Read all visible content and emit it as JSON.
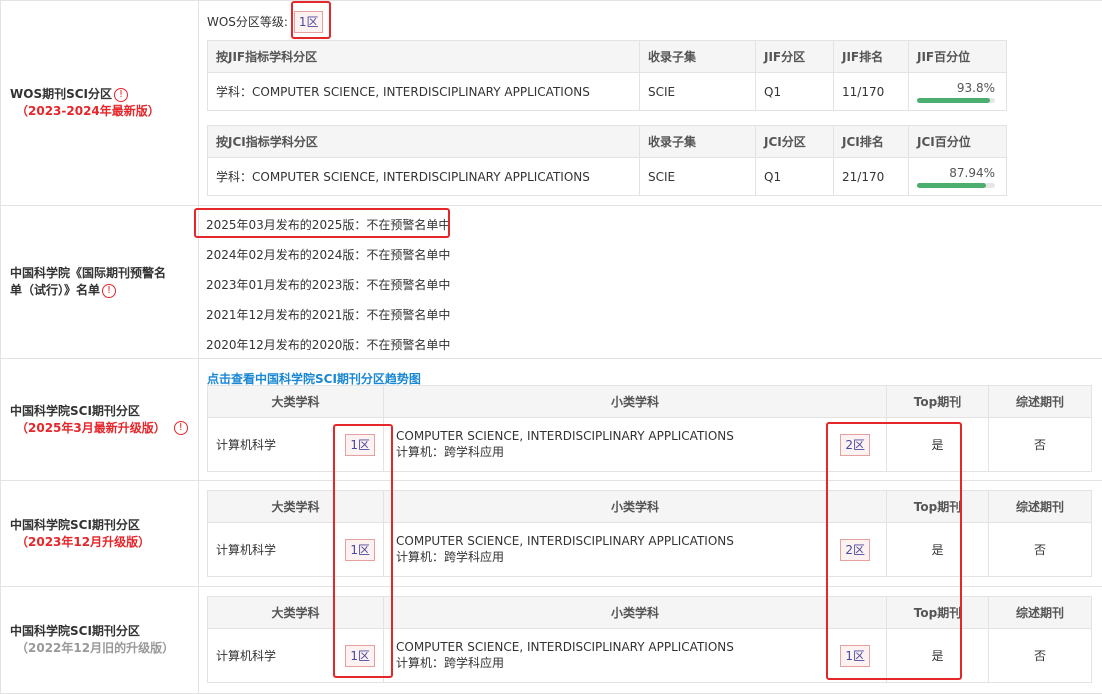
{
  "wos": {
    "label": "WOS期刊SCI分区",
    "sub": "（2023-2024年最新版）",
    "grade_label": "WOS分区等级:",
    "grade": "1区",
    "jif": {
      "headers": [
        "按JIF指标学科分区",
        "收录子集",
        "JIF分区",
        "JIF排名",
        "JIF百分位"
      ],
      "row": [
        "学科：COMPUTER SCIENCE, INTERDISCIPLINARY APPLICATIONS",
        "SCIE",
        "Q1",
        "11/170",
        "93.8%"
      ],
      "pct_value": 93.8
    },
    "jci": {
      "headers": [
        "按JCI指标学科分区",
        "收录子集",
        "JCI分区",
        "JCI排名",
        "JCI百分位"
      ],
      "row": [
        "学科：COMPUTER SCIENCE, INTERDISCIPLINARY APPLICATIONS",
        "SCIE",
        "Q1",
        "21/170",
        "87.94%"
      ],
      "pct_value": 87.94
    }
  },
  "warning": {
    "label": "中国科学院《国际期刊预警名单（试行）》名单",
    "items": [
      "2025年03月发布的2025版：不在预警名单中",
      "2024年02月发布的2024版：不在预警名单中",
      "2023年01月发布的2023版：不在预警名单中",
      "2021年12月发布的2021版：不在预警名单中",
      "2020年12月发布的2020版：不在预警名单中"
    ]
  },
  "cas": {
    "link": "点击查看中国科学院SCI期刊分区趋势图",
    "headers": [
      "大类学科",
      "小类学科",
      "Top期刊",
      "综述期刊"
    ],
    "sections": [
      {
        "label": "中国科学院SCI期刊分区",
        "sub": "（2025年3月最新升级版）",
        "major": "计算机科学",
        "major_zone": "1区",
        "minor_en": "COMPUTER SCIENCE, INTERDISCIPLINARY APPLICATIONS",
        "minor_cn": "计算机：跨学科应用",
        "minor_zone": "2区",
        "top": "是",
        "review": "否"
      },
      {
        "label": "中国科学院SCI期刊分区",
        "sub": "（2023年12月升级版）",
        "major": "计算机科学",
        "major_zone": "1区",
        "minor_en": "COMPUTER SCIENCE, INTERDISCIPLINARY APPLICATIONS",
        "minor_cn": "计算机：跨学科应用",
        "minor_zone": "2区",
        "top": "是",
        "review": "否"
      },
      {
        "label": "中国科学院SCI期刊分区",
        "sub": "（2022年12月旧的升级版）",
        "major": "计算机科学",
        "major_zone": "1区",
        "minor_en": "COMPUTER SCIENCE, INTERDISCIPLINARY APPLICATIONS",
        "minor_cn": "计算机：跨学科应用",
        "minor_zone": "1区",
        "top": "是",
        "review": "否"
      }
    ]
  },
  "colors": {
    "accent_red": "#e5262b",
    "link_blue": "#1a87d4",
    "bar_green": "#4cae6e"
  }
}
